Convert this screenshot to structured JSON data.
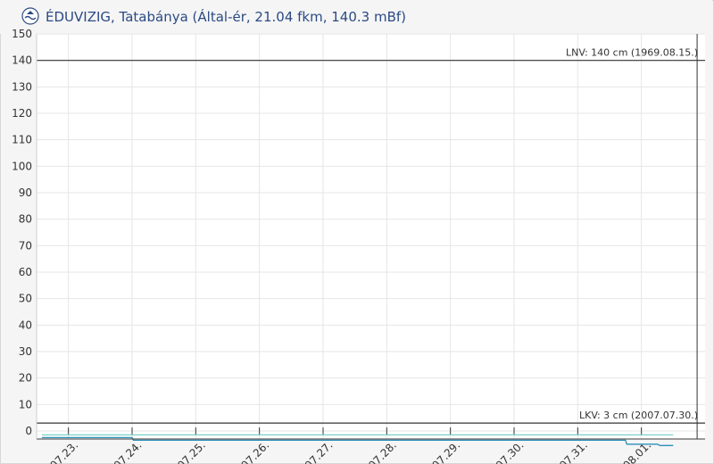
{
  "header": {
    "title": "ÉDUVIZIG, Tatabánya (Által-ér, 21.04 fkm, 140.3 mBf)",
    "logo_icon": "eduvizig-logo-icon"
  },
  "chart_data": {
    "type": "line",
    "title": "ÉDUVIZIG, Tatabánya (Által-ér, 21.04 fkm, 140.3 mBf)",
    "xlabel": "",
    "ylabel": "",
    "ylim": [
      0,
      150
    ],
    "yticks": [
      0,
      10,
      20,
      30,
      40,
      50,
      60,
      70,
      80,
      90,
      100,
      110,
      120,
      130,
      140,
      150
    ],
    "xlim": [
      "07.22. 12:00",
      "08.02. 00:00"
    ],
    "xtick_labels": [
      "07.23.",
      "07.24.",
      "07.25.",
      "07.26.",
      "07.27.",
      "07.28.",
      "07.29.",
      "07.30.",
      "07.31.",
      "08.01."
    ],
    "grid": true,
    "reference_lines": [
      {
        "name": "LNV",
        "value": 140,
        "label": "LNV: 140 cm (1969.08.15.)",
        "color": "#333333"
      },
      {
        "name": "LKV",
        "value": 3,
        "label": "LKV:  3 cm (2007.07.30.)",
        "color": "#333333"
      }
    ],
    "cursor_x": "08.01. 21:00",
    "series": [
      {
        "color": "#2a8fb8",
        "x": [
          "07.22. 14:00",
          "07.24. 00:00",
          "07.24. 00:30",
          "07.31. 18:00",
          "07.31. 18:30",
          "08.01. 06:00",
          "08.01. 07:00",
          "08.01. 12:00"
        ],
        "y": [
          -2.5,
          -2.5,
          -3.5,
          -3.5,
          -5,
          -5,
          -5.5,
          -5.5
        ]
      },
      {
        "color": "#7fd0c8",
        "x": [
          "07.22. 14:00",
          "08.01. 12:00"
        ],
        "y": [
          -1.5,
          -1.5
        ]
      }
    ]
  }
}
